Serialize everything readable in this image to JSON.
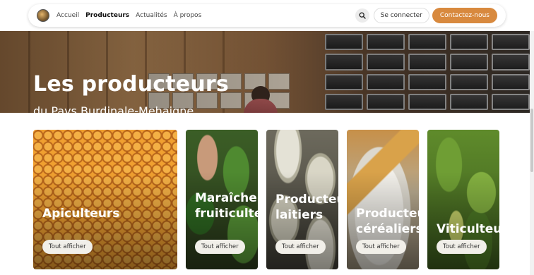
{
  "nav": {
    "links": [
      "Accueil",
      "Producteurs",
      "Actualités",
      "À propos"
    ],
    "active": "Producteurs",
    "login_label": "Se connecter",
    "contact_label": "Contactez-nous"
  },
  "hero": {
    "title": "Les producteurs",
    "subtitle": "du Pays Burdinale-Mehaigne"
  },
  "cards": [
    {
      "title": "Apiculteurs",
      "button": "Tout afficher"
    },
    {
      "title": "Maraîchers et fruiticulteurs",
      "button": "Tout afficher"
    },
    {
      "title": "Producteurs laitiers",
      "button": "Tout afficher"
    },
    {
      "title": "Producteurs céréaliers",
      "button": "Tout afficher"
    },
    {
      "title": "Viticulteurs",
      "button": "Tout afficher"
    }
  ],
  "colors": {
    "accent": "#d8893e",
    "text_dark": "#111111"
  },
  "icons": {
    "search": "search-icon",
    "logo": "site-logo"
  }
}
